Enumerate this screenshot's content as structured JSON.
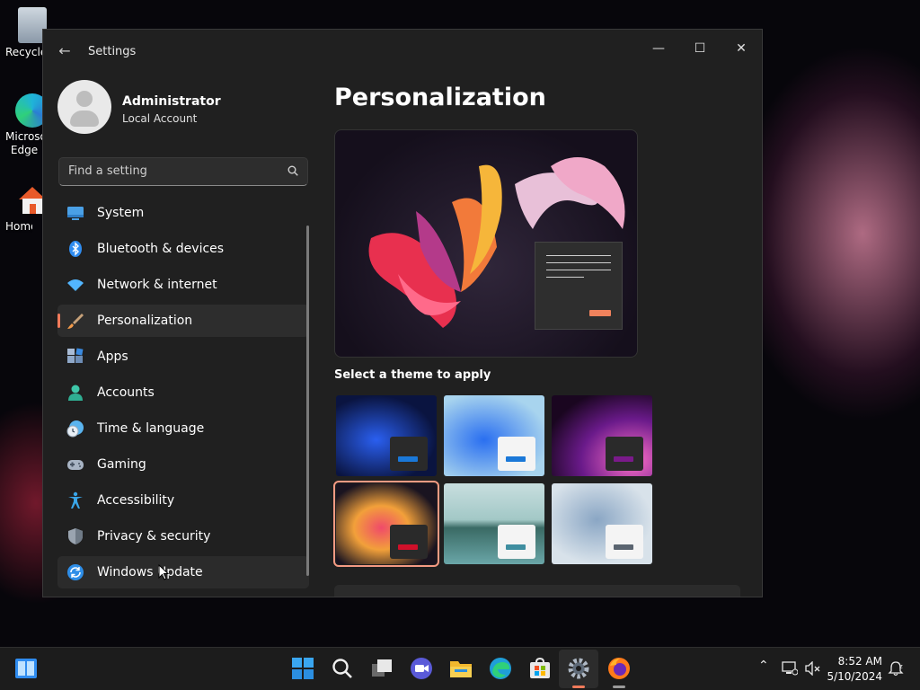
{
  "desktop": {
    "icons": [
      {
        "label": "Recycle Bin"
      },
      {
        "label": "Microsoft Edge"
      },
      {
        "label": "Home"
      }
    ]
  },
  "window": {
    "title": "Settings",
    "back_icon": "back-arrow-icon",
    "controls": {
      "minimize": "—",
      "maximize": "☐",
      "close": "✕"
    }
  },
  "profile": {
    "name": "Administrator",
    "account_type": "Local Account"
  },
  "search": {
    "placeholder": "Find a setting"
  },
  "nav": {
    "items": [
      {
        "label": "System",
        "icon": "display-icon",
        "color": "#4aa0e6"
      },
      {
        "label": "Bluetooth & devices",
        "icon": "bluetooth-icon",
        "color": "#2f8cf0"
      },
      {
        "label": "Network & internet",
        "icon": "wifi-icon",
        "color": "#52b6ff"
      },
      {
        "label": "Personalization",
        "icon": "paintbrush-icon",
        "color": "#f29a4a"
      },
      {
        "label": "Apps",
        "icon": "apps-icon",
        "color": "#8fa8c8"
      },
      {
        "label": "Accounts",
        "icon": "person-icon",
        "color": "#3ec6a8"
      },
      {
        "label": "Time & language",
        "icon": "clock-globe-icon",
        "color": "#5ab4ef"
      },
      {
        "label": "Gaming",
        "icon": "gamepad-icon",
        "color": "#a8b4c4"
      },
      {
        "label": "Accessibility",
        "icon": "accessibility-icon",
        "color": "#3aa6e8"
      },
      {
        "label": "Privacy & security",
        "icon": "shield-icon",
        "color": "#9aa4b0"
      },
      {
        "label": "Windows Update",
        "icon": "update-icon",
        "color": "#2e8ee8"
      }
    ],
    "active_index": 3
  },
  "content": {
    "title": "Personalization",
    "themes_heading": "Select a theme to apply",
    "themes": [
      {
        "name": "windows-light-bloom-dark",
        "accent": "#1a78d8",
        "window": "#2a2a2a",
        "selected": false
      },
      {
        "name": "windows-light-bloom",
        "accent": "#1a78d8",
        "window": "#f4f4f4",
        "selected": false
      },
      {
        "name": "glow",
        "accent": "#7a1a8a",
        "window": "#2a2a2a",
        "selected": false
      },
      {
        "name": "captured-motion",
        "accent": "#d0102a",
        "window": "#2a2a2a",
        "selected": true
      },
      {
        "name": "sunrise",
        "accent": "#3f8ea0",
        "window": "#f4f4f4",
        "selected": false
      },
      {
        "name": "flow",
        "accent": "#5a6470",
        "window": "#f4f4f4",
        "selected": false
      }
    ]
  },
  "taskbar": {
    "apps": [
      "windows-logo-icon",
      "search-icon",
      "task-view-icon",
      "meet-icon",
      "file-explorer-icon",
      "edge-icon",
      "store-icon",
      "settings-icon",
      "firefox-icon"
    ],
    "time": "8:52 AM",
    "date": "5/10/2024"
  }
}
